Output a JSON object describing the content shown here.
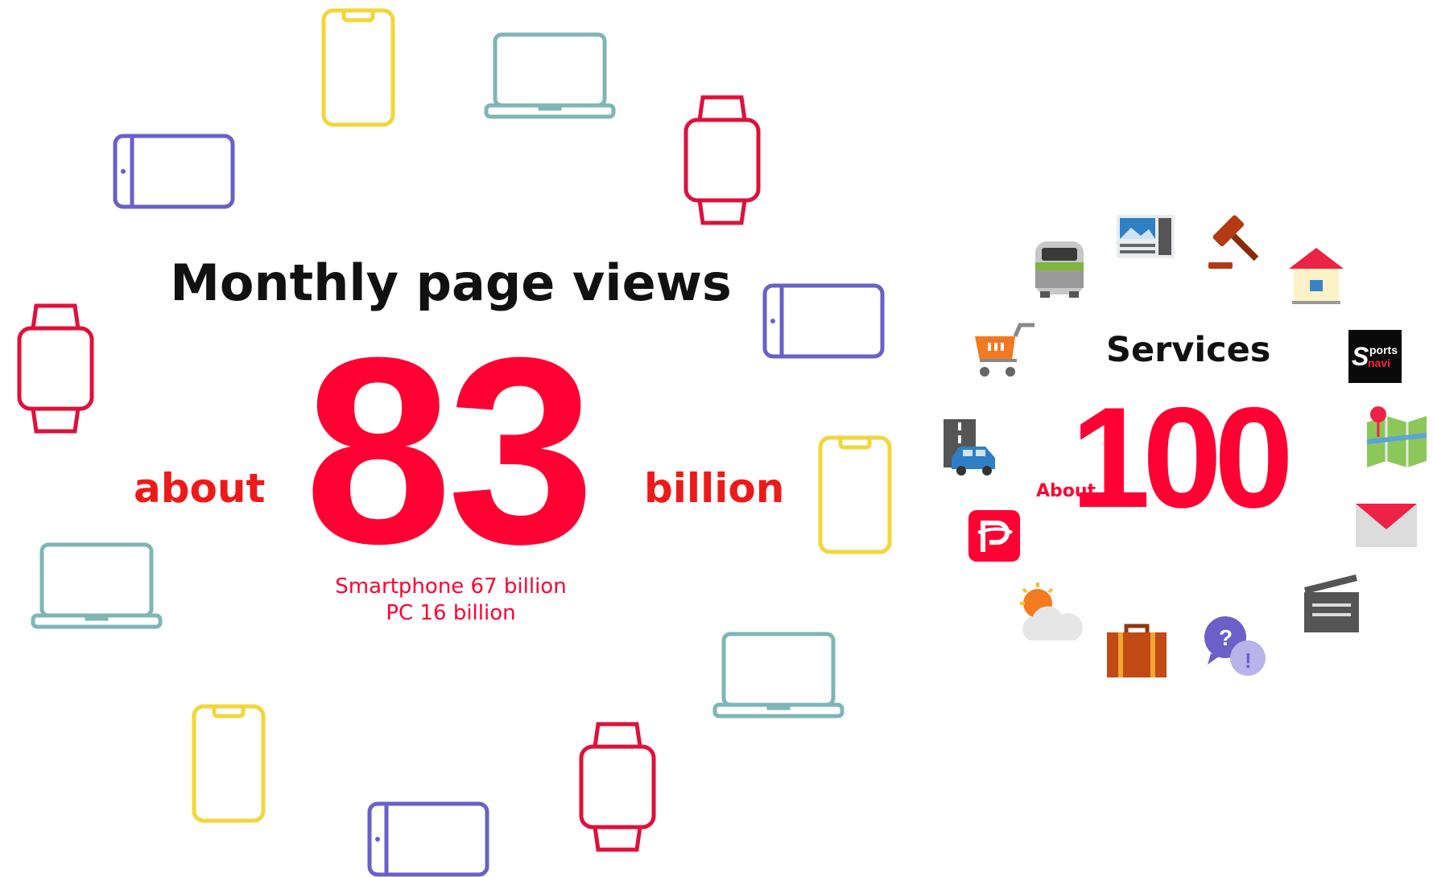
{
  "main": {
    "title": "Monthly page views",
    "prefix": "about",
    "value": "83",
    "suffix": "billion",
    "breakdown": [
      "Smartphone 67 billion",
      "PC 16 billion"
    ]
  },
  "services": {
    "label": "Services",
    "prefix": "About",
    "value": "100",
    "logo_text": "Sports navi"
  },
  "colors": {
    "accent": "#ff0033",
    "phone": "#f2d63a",
    "laptop": "#7fb5b5",
    "watch": "#e0103a",
    "tablet": "#6a60c8"
  },
  "icons": [
    "phone-icon",
    "laptop-icon",
    "watch-icon",
    "tablet-icon",
    "train-icon",
    "news-icon",
    "auction-icon",
    "house-icon",
    "shopping-cart-icon",
    "sportsnavi-logo",
    "road-car-icon",
    "map-icon",
    "paypay-icon",
    "mail-icon",
    "weather-icon",
    "movie-clapper-icon",
    "briefcase-icon",
    "qa-icon"
  ]
}
